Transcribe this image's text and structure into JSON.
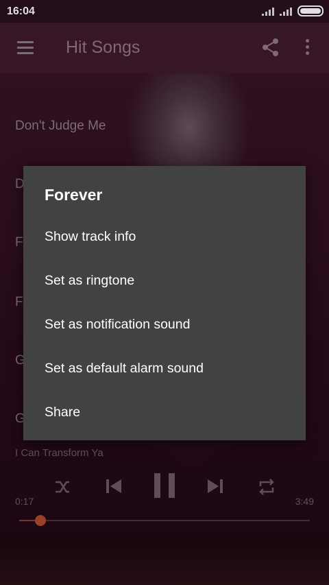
{
  "status_bar": {
    "time": "16:04"
  },
  "toolbar": {
    "title": "Hit Songs"
  },
  "song_list": [
    {
      "title": "Don't Judge Me"
    },
    {
      "title": "D"
    },
    {
      "title": "F"
    },
    {
      "title": "F"
    },
    {
      "title": "G"
    },
    {
      "title": "G"
    }
  ],
  "player": {
    "now_playing": "I Can Transform Ya",
    "current_time": "0:17",
    "total_time": "3:49",
    "progress": 0.073
  },
  "dialog": {
    "title": "Forever",
    "items": [
      {
        "label": "Show track info"
      },
      {
        "label": "Set as ringtone"
      },
      {
        "label": "Set as notification sound"
      },
      {
        "label": "Set as default alarm sound"
      },
      {
        "label": "Share"
      }
    ]
  },
  "colors": {
    "dialog_bg": "#424242",
    "toolbar_bg": "#3f1a2e",
    "seek_accent": "#b04a30"
  }
}
